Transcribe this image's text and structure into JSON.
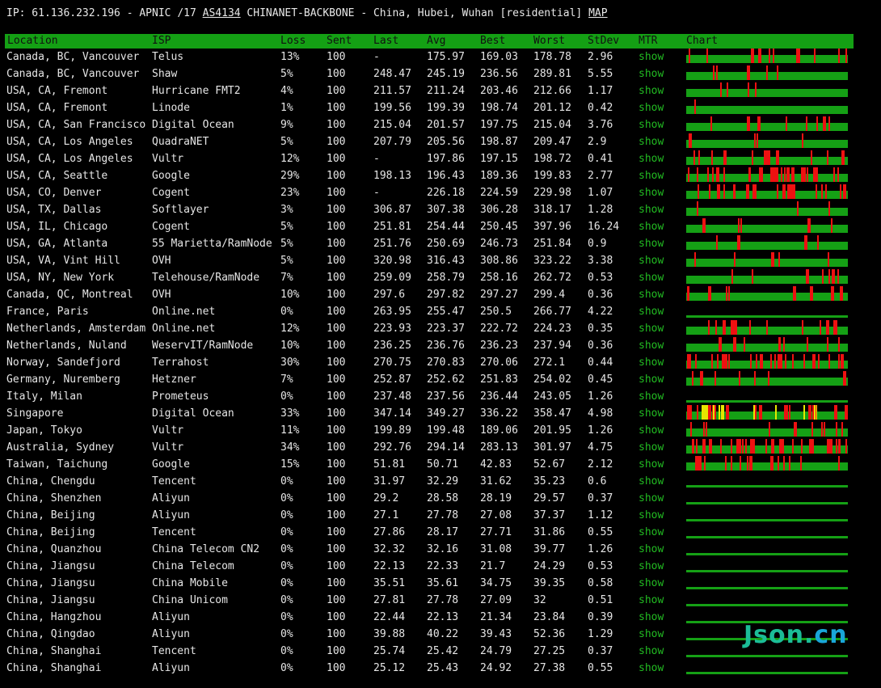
{
  "header": {
    "ip_prefix": "IP: 61.136.232.196 - APNIC /17 ",
    "asn_link": "AS4134",
    "owner": " CHINANET-BACKBONE - China, Hubei, Wuhan [residential] ",
    "map_link": "MAP"
  },
  "columns": [
    "Location",
    "ISP",
    "Loss",
    "Sent",
    "Last",
    "Avg",
    "Best",
    "Worst",
    "StDev",
    "MTR",
    "Chart"
  ],
  "colors": {
    "header_bg": "#14a014",
    "bar_ok": "#15a015",
    "bar_loss": "#ee1111",
    "bar_warn": "#e6e600",
    "mtr_link": "#22bb22"
  },
  "rows": [
    {
      "location": "Canada, BC, Vancouver",
      "isp": "Telus",
      "loss": "13%",
      "sent": "100",
      "last": "-",
      "avg": "175.97",
      "best": "169.03",
      "worst": "178.78",
      "stdev": "2.96",
      "mtr": "show"
    },
    {
      "location": "Canada, BC, Vancouver",
      "isp": "Shaw",
      "loss": "5%",
      "sent": "100",
      "last": "248.47",
      "avg": "245.19",
      "best": "236.56",
      "worst": "289.81",
      "stdev": "5.55",
      "mtr": "show"
    },
    {
      "location": "USA, CA, Fremont",
      "isp": "Hurricane FMT2",
      "loss": "4%",
      "sent": "100",
      "last": "211.57",
      "avg": "211.24",
      "best": "203.46",
      "worst": "212.66",
      "stdev": "1.17",
      "mtr": "show"
    },
    {
      "location": "USA, CA, Fremont",
      "isp": "Linode",
      "loss": "1%",
      "sent": "100",
      "last": "199.56",
      "avg": "199.39",
      "best": "198.74",
      "worst": "201.12",
      "stdev": "0.42",
      "mtr": "show"
    },
    {
      "location": "USA, CA, San Francisco",
      "isp": "Digital Ocean",
      "loss": "9%",
      "sent": "100",
      "last": "215.04",
      "avg": "201.57",
      "best": "197.75",
      "worst": "215.04",
      "stdev": "3.76",
      "mtr": "show"
    },
    {
      "location": "USA, CA, Los Angeles",
      "isp": "QuadraNET",
      "loss": "5%",
      "sent": "100",
      "last": "207.79",
      "avg": "205.56",
      "best": "198.87",
      "worst": "209.47",
      "stdev": "2.9",
      "mtr": "show"
    },
    {
      "location": "USA, CA, Los Angeles",
      "isp": "Vultr",
      "loss": "12%",
      "sent": "100",
      "last": "-",
      "avg": "197.86",
      "best": "197.15",
      "worst": "198.72",
      "stdev": "0.41",
      "mtr": "show"
    },
    {
      "location": "USA, CA, Seattle",
      "isp": "Google",
      "loss": "29%",
      "sent": "100",
      "last": "198.13",
      "avg": "196.43",
      "best": "189.36",
      "worst": "199.83",
      "stdev": "2.77",
      "mtr": "show"
    },
    {
      "location": "USA, CO, Denver",
      "isp": "Cogent",
      "loss": "23%",
      "sent": "100",
      "last": "-",
      "avg": "226.18",
      "best": "224.59",
      "worst": "229.98",
      "stdev": "1.07",
      "mtr": "show"
    },
    {
      "location": "USA, TX, Dallas",
      "isp": "Softlayer",
      "loss": "3%",
      "sent": "100",
      "last": "306.87",
      "avg": "307.38",
      "best": "306.28",
      "worst": "318.17",
      "stdev": "1.28",
      "mtr": "show"
    },
    {
      "location": "USA, IL, Chicago",
      "isp": "Cogent",
      "loss": "5%",
      "sent": "100",
      "last": "251.81",
      "avg": "254.44",
      "best": "250.45",
      "worst": "397.96",
      "stdev": "16.24",
      "mtr": "show"
    },
    {
      "location": "USA, GA, Atlanta",
      "isp": "55 Marietta/RamNode",
      "loss": "5%",
      "sent": "100",
      "last": "251.76",
      "avg": "250.69",
      "best": "246.73",
      "worst": "251.84",
      "stdev": "0.9",
      "mtr": "show"
    },
    {
      "location": "USA, VA, Vint Hill",
      "isp": "OVH",
      "loss": "5%",
      "sent": "100",
      "last": "320.98",
      "avg": "316.43",
      "best": "308.86",
      "worst": "323.22",
      "stdev": "3.38",
      "mtr": "show"
    },
    {
      "location": "USA, NY, New York",
      "isp": "Telehouse/RamNode",
      "loss": "7%",
      "sent": "100",
      "last": "259.09",
      "avg": "258.79",
      "best": "258.16",
      "worst": "262.72",
      "stdev": "0.53",
      "mtr": "show"
    },
    {
      "location": "Canada, QC, Montreal",
      "isp": "OVH",
      "loss": "10%",
      "sent": "100",
      "last": "297.6",
      "avg": "297.82",
      "best": "297.27",
      "worst": "299.4",
      "stdev": "0.36",
      "mtr": "show"
    },
    {
      "location": "France, Paris",
      "isp": "Online.net",
      "loss": "0%",
      "sent": "100",
      "last": "263.95",
      "avg": "255.47",
      "best": "250.5",
      "worst": "266.77",
      "stdev": "4.22",
      "mtr": "show"
    },
    {
      "location": "Netherlands, Amsterdam",
      "isp": "Online.net",
      "loss": "12%",
      "sent": "100",
      "last": "223.93",
      "avg": "223.37",
      "best": "222.72",
      "worst": "224.23",
      "stdev": "0.35",
      "mtr": "show"
    },
    {
      "location": "Netherlands, Nuland",
      "isp": "WeservIT/RamNode",
      "loss": "10%",
      "sent": "100",
      "last": "236.25",
      "avg": "236.76",
      "best": "236.23",
      "worst": "237.94",
      "stdev": "0.36",
      "mtr": "show"
    },
    {
      "location": "Norway, Sandefjord",
      "isp": "Terrahost",
      "loss": "30%",
      "sent": "100",
      "last": "270.75",
      "avg": "270.83",
      "best": "270.06",
      "worst": "272.1",
      "stdev": "0.44",
      "mtr": "show"
    },
    {
      "location": "Germany, Nuremberg",
      "isp": "Hetzner",
      "loss": "7%",
      "sent": "100",
      "last": "252.87",
      "avg": "252.62",
      "best": "251.83",
      "worst": "254.02",
      "stdev": "0.45",
      "mtr": "show"
    },
    {
      "location": "Italy, Milan",
      "isp": "Prometeus",
      "loss": "0%",
      "sent": "100",
      "last": "237.48",
      "avg": "237.56",
      "best": "236.44",
      "worst": "243.05",
      "stdev": "1.26",
      "mtr": "show"
    },
    {
      "location": "Singapore",
      "isp": "Digital Ocean",
      "loss": "33%",
      "sent": "100",
      "last": "347.14",
      "avg": "349.27",
      "best": "336.22",
      "worst": "358.47",
      "stdev": "4.98",
      "mtr": "show"
    },
    {
      "location": "Japan, Tokyo",
      "isp": "Vultr",
      "loss": "11%",
      "sent": "100",
      "last": "199.89",
      "avg": "199.48",
      "best": "189.06",
      "worst": "201.95",
      "stdev": "1.26",
      "mtr": "show"
    },
    {
      "location": "Australia, Sydney",
      "isp": "Vultr",
      "loss": "34%",
      "sent": "100",
      "last": "292.76",
      "avg": "294.14",
      "best": "283.13",
      "worst": "301.97",
      "stdev": "4.75",
      "mtr": "show"
    },
    {
      "location": "Taiwan, Taichung",
      "isp": "Google",
      "loss": "15%",
      "sent": "100",
      "last": "51.81",
      "avg": "50.71",
      "best": "42.83",
      "worst": "52.67",
      "stdev": "2.12",
      "mtr": "show"
    },
    {
      "location": "China, Chengdu",
      "isp": "Tencent",
      "loss": "0%",
      "sent": "100",
      "last": "31.97",
      "avg": "32.29",
      "best": "31.62",
      "worst": "35.23",
      "stdev": "0.6",
      "mtr": "show"
    },
    {
      "location": "China, Shenzhen",
      "isp": "Aliyun",
      "loss": "0%",
      "sent": "100",
      "last": "29.2",
      "avg": "28.58",
      "best": "28.19",
      "worst": "29.57",
      "stdev": "0.37",
      "mtr": "show"
    },
    {
      "location": "China, Beijing",
      "isp": "Aliyun",
      "loss": "0%",
      "sent": "100",
      "last": "27.1",
      "avg": "27.78",
      "best": "27.08",
      "worst": "37.37",
      "stdev": "1.12",
      "mtr": "show"
    },
    {
      "location": "China, Beijing",
      "isp": "Tencent",
      "loss": "0%",
      "sent": "100",
      "last": "27.86",
      "avg": "28.17",
      "best": "27.71",
      "worst": "31.86",
      "stdev": "0.55",
      "mtr": "show"
    },
    {
      "location": "China, Quanzhou",
      "isp": "China Telecom CN2",
      "loss": "0%",
      "sent": "100",
      "last": "32.32",
      "avg": "32.16",
      "best": "31.08",
      "worst": "39.77",
      "stdev": "1.26",
      "mtr": "show"
    },
    {
      "location": "China, Jiangsu",
      "isp": "China Telecom",
      "loss": "0%",
      "sent": "100",
      "last": "22.13",
      "avg": "22.33",
      "best": "21.7",
      "worst": "24.29",
      "stdev": "0.53",
      "mtr": "show"
    },
    {
      "location": "China, Jiangsu",
      "isp": "China Mobile",
      "loss": "0%",
      "sent": "100",
      "last": "35.51",
      "avg": "35.61",
      "best": "34.75",
      "worst": "39.35",
      "stdev": "0.58",
      "mtr": "show"
    },
    {
      "location": "China, Jiangsu",
      "isp": "China Unicom",
      "loss": "0%",
      "sent": "100",
      "last": "27.81",
      "avg": "27.78",
      "best": "27.09",
      "worst": "32",
      "stdev": "0.51",
      "mtr": "show"
    },
    {
      "location": "China, Hangzhou",
      "isp": "Aliyun",
      "loss": "0%",
      "sent": "100",
      "last": "22.44",
      "avg": "22.13",
      "best": "21.34",
      "worst": "23.84",
      "stdev": "0.39",
      "mtr": "show"
    },
    {
      "location": "China, Qingdao",
      "isp": "Aliyun",
      "loss": "0%",
      "sent": "100",
      "last": "39.88",
      "avg": "40.22",
      "best": "39.43",
      "worst": "52.36",
      "stdev": "1.29",
      "mtr": "show"
    },
    {
      "location": "China, Shanghai",
      "isp": "Tencent",
      "loss": "0%",
      "sent": "100",
      "last": "25.74",
      "avg": "25.42",
      "best": "24.79",
      "worst": "27.25",
      "stdev": "0.37",
      "mtr": "show"
    },
    {
      "location": "China, Shanghai",
      "isp": "Aliyun",
      "loss": "0%",
      "sent": "100",
      "last": "25.12",
      "avg": "25.43",
      "best": "24.92",
      "worst": "27.38",
      "stdev": "0.55",
      "mtr": "show"
    }
  ],
  "watermark": {
    "main": "Json",
    "dot": ".",
    "suffix": "cn"
  }
}
